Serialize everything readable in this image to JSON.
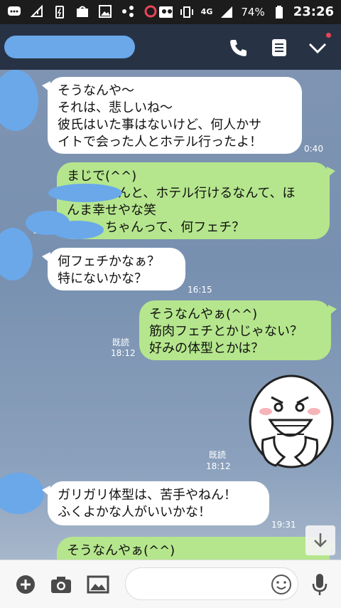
{
  "status_bar": {
    "network": "4G",
    "battery": "74%",
    "time": "23:26"
  },
  "messages": [
    {
      "side": "left",
      "lines": [
        "そうなんや〜",
        "それは、悲しいね〜",
        "彼氏はいた事はないけど、何人かサ",
        "イトで会った人とホテル行ったよ！"
      ],
      "time": "0:40"
    },
    {
      "side": "right",
      "lines": [
        "まじで(^^)",
        "ん　　　んと、ホテル行けるなんて、ほ",
        "んま幸せやな笑",
        "　　　ちゃんって、何フェチ？"
      ],
      "read": "既読",
      "time": "0:4"
    },
    {
      "side": "left",
      "lines": [
        "何フェチかなぁ？",
        "特にないかな？"
      ],
      "time": "16:15"
    },
    {
      "side": "right",
      "lines": [
        "そうなんやぁ(^^)",
        "筋肉フェチとかじゃない？",
        "好みの体型とかは？"
      ],
      "read": "既読",
      "time": "18:12"
    },
    {
      "side": "right",
      "type": "sticker",
      "sticker": "grinning-moon-sticker",
      "read": "既読",
      "time": "18:12"
    },
    {
      "side": "left",
      "lines": [
        "ガリガリ体型は、苦手やねん！",
        "ふくよかな人がいいかな！"
      ],
      "time": "19:31"
    },
    {
      "side": "right",
      "lines": [
        "そうなんやぁ(^^)"
      ]
    }
  ],
  "colors": {
    "header_bg": "#273345",
    "chat_bg": "#7b93b4",
    "bubble_sent": "#b5e68d",
    "bubble_received": "#ffffff",
    "redaction": "#6aa8ea"
  }
}
